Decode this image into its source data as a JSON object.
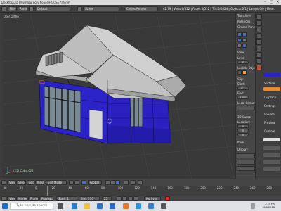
{
  "window": {
    "title": "Desktop\\3D Drive\\low poly house\\HOUSE *alone\\"
  },
  "infobar": {
    "editor_type_icon": "info-icon",
    "menus": [
      "File",
      "Render",
      "Window",
      "Help"
    ],
    "screen_layout": "Default",
    "scene": "Scene",
    "render_engine": "Cycles Render",
    "stats": "v2.79 | Verts:0/512 | Faces:0/512 | Tris:0/1024 | Objects:0/1 | Lamps:0/0 | Mem:"
  },
  "viewport": {
    "view_label": "User Ortho",
    "object_label": "(25) Cube.022",
    "colors": {
      "background": "#393939",
      "grid": "#454545",
      "wall": "#2b22c8",
      "wall_dark": "#1c1590",
      "roof": "#c9c9c9",
      "window_glass": "#7a8a95",
      "door": "#d4d4d4",
      "selection": "#e08a00"
    }
  },
  "npanel": {
    "sections": [
      {
        "label": "Transform"
      },
      {
        "label": "Relations"
      },
      {
        "label": "Grease Pencil"
      },
      {
        "label": "View"
      },
      {
        "label": "Lens:"
      },
      {
        "label": "Lock to Object"
      },
      {
        "label": "Clip:"
      },
      {
        "label": "Start:"
      },
      {
        "label": "End:"
      },
      {
        "label": "Local Camera"
      },
      {
        "label": "3D Cursor"
      },
      {
        "label": "Location:"
      },
      {
        "label": "Item"
      },
      {
        "label": "Display"
      }
    ],
    "fields": {
      "lens": "35",
      "clip_start": "0.1",
      "clip_end": "1000",
      "cursor_x": "0",
      "cursor_y": "0",
      "cursor_z": "0"
    }
  },
  "rightpanel": {
    "tabs": [
      "render-icon",
      "layers-icon",
      "scene-icon",
      "world-icon",
      "object-icon",
      "constraints-icon",
      "modifiers-icon",
      "data-icon",
      "material-icon"
    ],
    "labels": [
      "Surface",
      "Displace",
      "Settings",
      "Volume",
      "Preview",
      "Custom"
    ],
    "swatch_color": "#2b22c8"
  },
  "vp_header": {
    "menus": [
      "View",
      "Select",
      "Add",
      "Mesh"
    ],
    "mode": "Edit Mode",
    "pivot": "Global",
    "snap": "No Sync"
  },
  "timeline": {
    "ticks": [
      "-40",
      "-20",
      "0",
      "20",
      "40",
      "60",
      "80",
      "100",
      "120",
      "140",
      "160",
      "180",
      "200",
      "220",
      "240",
      "260",
      "280"
    ],
    "menus": [
      "View",
      "Marker",
      "Frame",
      "Playback"
    ],
    "start_label": "Start:",
    "start_value": "1",
    "end_label": "End:",
    "end_value": "250",
    "frame_value": "25",
    "sync": "No Sync"
  },
  "taskbar": {
    "search_placeholder": "Type here to search",
    "apps": [
      "task-view-icon",
      "edge-icon",
      "file-explorer-icon",
      "store-icon",
      "mail-icon",
      "blender-icon",
      "dropbox-icon",
      "photos-icon",
      "settings-icon"
    ],
    "time": "7:35 PM",
    "date": "10/6/2018"
  }
}
